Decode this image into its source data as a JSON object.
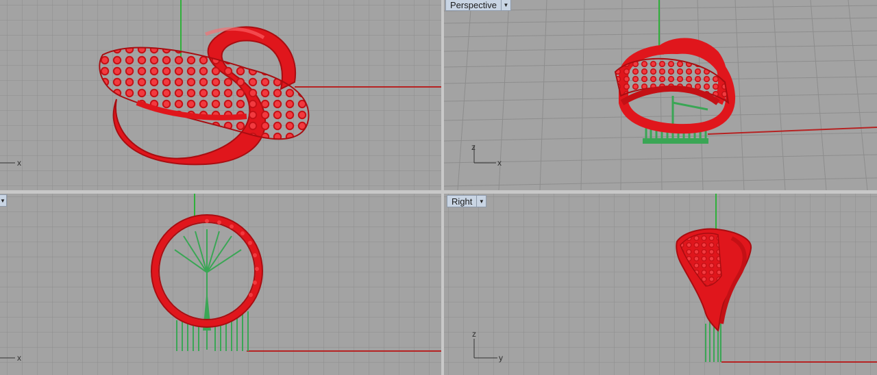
{
  "viewports": [
    {
      "name": "",
      "axes": [
        "x",
        ""
      ]
    },
    {
      "name": "Perspective",
      "axes": [
        "x",
        "z"
      ]
    },
    {
      "name": "",
      "axes": [
        "x",
        ""
      ]
    },
    {
      "name": "Right",
      "axes": [
        "y",
        "z"
      ]
    }
  ],
  "colors": {
    "background": "#a3a3a3",
    "grid": "#8a8a8a",
    "object": "#e0161c",
    "supports": "#3aa655",
    "x_axis": "#b51d1d",
    "y_axis": "#33a033"
  },
  "icons": {
    "dropdown": "dropdown-arrow-icon"
  }
}
